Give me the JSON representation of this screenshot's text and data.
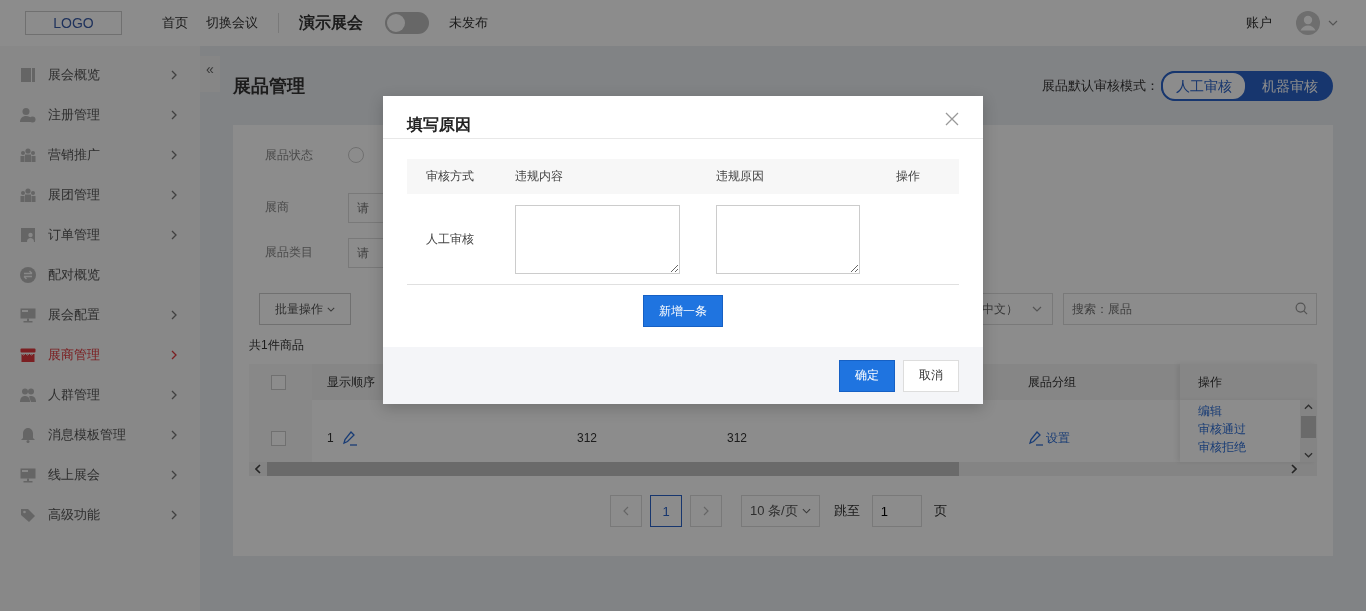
{
  "header": {
    "logo": "LOGO",
    "nav": [
      "首页",
      "切换会议"
    ],
    "event_title": "演示展会",
    "publish_toggle": {
      "on": false
    },
    "publish_status": "未发布",
    "account": "账户"
  },
  "sidebar": {
    "collapse": "«",
    "items": [
      {
        "label": "展会概览",
        "submenu": true,
        "selected": false
      },
      {
        "label": "注册管理",
        "submenu": true,
        "selected": false
      },
      {
        "label": "营销推广",
        "submenu": true,
        "selected": false
      },
      {
        "label": "展团管理",
        "submenu": true,
        "selected": false
      },
      {
        "label": "订单管理",
        "submenu": true,
        "selected": false
      },
      {
        "label": "配对概览",
        "submenu": false,
        "selected": false
      },
      {
        "label": "展会配置",
        "submenu": true,
        "selected": false
      },
      {
        "label": "展商管理",
        "submenu": true,
        "selected": true
      },
      {
        "label": "人群管理",
        "submenu": true,
        "selected": false
      },
      {
        "label": "消息模板管理",
        "submenu": true,
        "selected": false
      },
      {
        "label": "线上展会",
        "submenu": true,
        "selected": false
      },
      {
        "label": "高级功能",
        "submenu": true,
        "selected": false
      }
    ]
  },
  "page": {
    "title": "展品管理",
    "review_mode": {
      "label": "展品默认审核模式：",
      "options": [
        {
          "label": "人工审核",
          "selected": true
        },
        {
          "label": "机器审核",
          "selected": false
        }
      ]
    }
  },
  "filters": [
    {
      "label": "展品状态",
      "kind": "radio",
      "checked": false
    },
    {
      "label": "展商",
      "kind": "input",
      "placeholder": "请"
    },
    {
      "label": "展品类目",
      "kind": "input",
      "placeholder": "请"
    }
  ],
  "toolbar": {
    "batch": "批量操作",
    "language_select": "中文）",
    "search": {
      "placeholder": "搜索：展品"
    }
  },
  "count": "共1件商品",
  "table": {
    "header_checked": false,
    "columns": [
      "显示顺序",
      "展品分组",
      "操作"
    ],
    "rows": [
      {
        "checked": false,
        "order": "1",
        "column_3": "312",
        "column_4": "312",
        "group": "设置",
        "actions": [
          "编辑",
          "审核通过",
          "审核拒绝"
        ]
      }
    ]
  },
  "pagination": {
    "pages": [
      {
        "label": "1",
        "selected": true
      }
    ],
    "page_size": "10 条/页",
    "jump_label": "跳至",
    "jump_value": "1",
    "jump_unit": "页"
  },
  "dialog": {
    "title": "填写原因",
    "columns": [
      "审核方式",
      "违规内容",
      "违规原因",
      "操作"
    ],
    "rows": [
      {
        "method": "人工审核"
      }
    ],
    "add": "新增一条",
    "confirm": "确定",
    "cancel": "取消"
  }
}
